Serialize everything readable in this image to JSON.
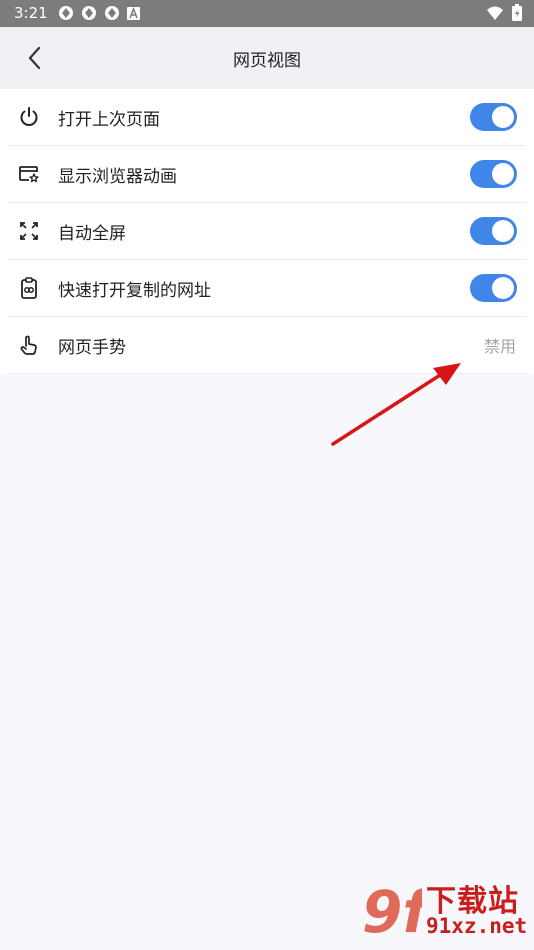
{
  "status_bar": {
    "time": "3:21",
    "notification_icons": [
      "sync-icon",
      "sync-icon",
      "sync-icon",
      "font-icon"
    ],
    "right_icons": [
      "wifi-icon",
      "battery-icon"
    ]
  },
  "header": {
    "title": "网页视图",
    "back_icon": "chevron-left-icon"
  },
  "settings": [
    {
      "icon": "power-icon",
      "label": "打开上次页面",
      "control": "toggle",
      "on": true
    },
    {
      "icon": "browser-star-icon",
      "label": "显示浏览器动画",
      "control": "toggle",
      "on": true
    },
    {
      "icon": "fullscreen-icon",
      "label": "自动全屏",
      "control": "toggle",
      "on": true
    },
    {
      "icon": "clipboard-link-icon",
      "label": "快速打开复制的网址",
      "control": "toggle",
      "on": true
    },
    {
      "icon": "gesture-hand-icon",
      "label": "网页手势",
      "control": "value",
      "value": "禁用"
    }
  ],
  "colors": {
    "accent": "#3f86e8",
    "status_bar": "#7c7c7c",
    "annotation_arrow": "#d81414",
    "watermark": "#c81e1e"
  },
  "watermark": {
    "logo_text": "9f",
    "brand": "下载站",
    "domain": "91xz.net"
  }
}
